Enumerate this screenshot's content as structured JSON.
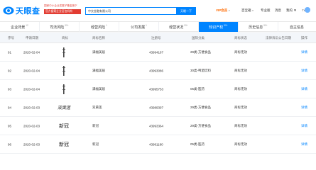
{
  "header": {
    "logo_text": "天眼查",
    "promo_line1": "国家中小企业发展子基金旗下",
    "promo_line2": "官方备案企业征信机构",
    "search_value": "中交金融有限公司",
    "search_button": "天眼一下",
    "nav": [
      {
        "label": "VIP会员",
        "type": "vip"
      },
      {
        "label": "百宝箱",
        "type": "dropdown"
      },
      {
        "label": "专业版",
        "type": "plain"
      },
      {
        "label": "消息",
        "type": "plain"
      },
      {
        "label": "我的 ▼",
        "type": "plain"
      },
      {
        "label": "TYCO",
        "type": "plain"
      }
    ]
  },
  "tabs": [
    {
      "label": "企业背景",
      "badge": "12"
    },
    {
      "label": "司法风险",
      "badge": "99+"
    },
    {
      "label": "经营风险",
      "badge": "1"
    },
    {
      "label": "公司发展",
      "badge": "1"
    },
    {
      "label": "经营状况",
      "badge": "99+"
    },
    {
      "label": "知识产权",
      "badge": "99+",
      "active": true
    },
    {
      "label": "历史信息",
      "badge": "99+"
    },
    {
      "label": "自主信息",
      "badge": ""
    }
  ],
  "table": {
    "headers": [
      "序号",
      "申请日期",
      "商标",
      "商标名称",
      "注册号",
      "国际分类",
      "商标状态",
      "法律诉讼公告日期",
      "操作"
    ],
    "rows": [
      {
        "index": "91",
        "date": "2020-02-04",
        "mark": "vertical",
        "name": "满福美居",
        "reg_no": "43994167",
        "category": "29类-方便食品",
        "status": "商标无效",
        "action": "详情"
      },
      {
        "index": "92",
        "date": "2020-02-04",
        "mark": "vertical",
        "name": "满福美居",
        "reg_no": "43993086",
        "category": "30类-啤酒饮料",
        "status": "商标无效",
        "action": "详情"
      },
      {
        "index": "93",
        "date": "2020-02-04",
        "mark": "vertical",
        "name": "满福美居",
        "reg_no": "43995753",
        "category": "05类-医药",
        "status": "商标无效",
        "action": "详情"
      },
      {
        "index": "94",
        "date": "2020-02-03",
        "mark": "calligraphy",
        "mark_text": "双黄莲",
        "name": "双黄莲",
        "reg_no": "43989397",
        "category": "29类-方便食品",
        "status": "商标无效",
        "action": "详情"
      },
      {
        "index": "95",
        "date": "2020-02-03",
        "mark": "text",
        "mark_text": "新冠",
        "name": "新冠",
        "reg_no": "43993364",
        "category": "29类-方便食品",
        "status": "商标无效",
        "action": "详情"
      },
      {
        "index": "96",
        "date": "2020-02-03",
        "mark": "text",
        "mark_text": "新冠",
        "name": "新冠",
        "reg_no": "43981180",
        "category": "05类-医药",
        "status": "商标无效",
        "action": "详情"
      }
    ]
  }
}
